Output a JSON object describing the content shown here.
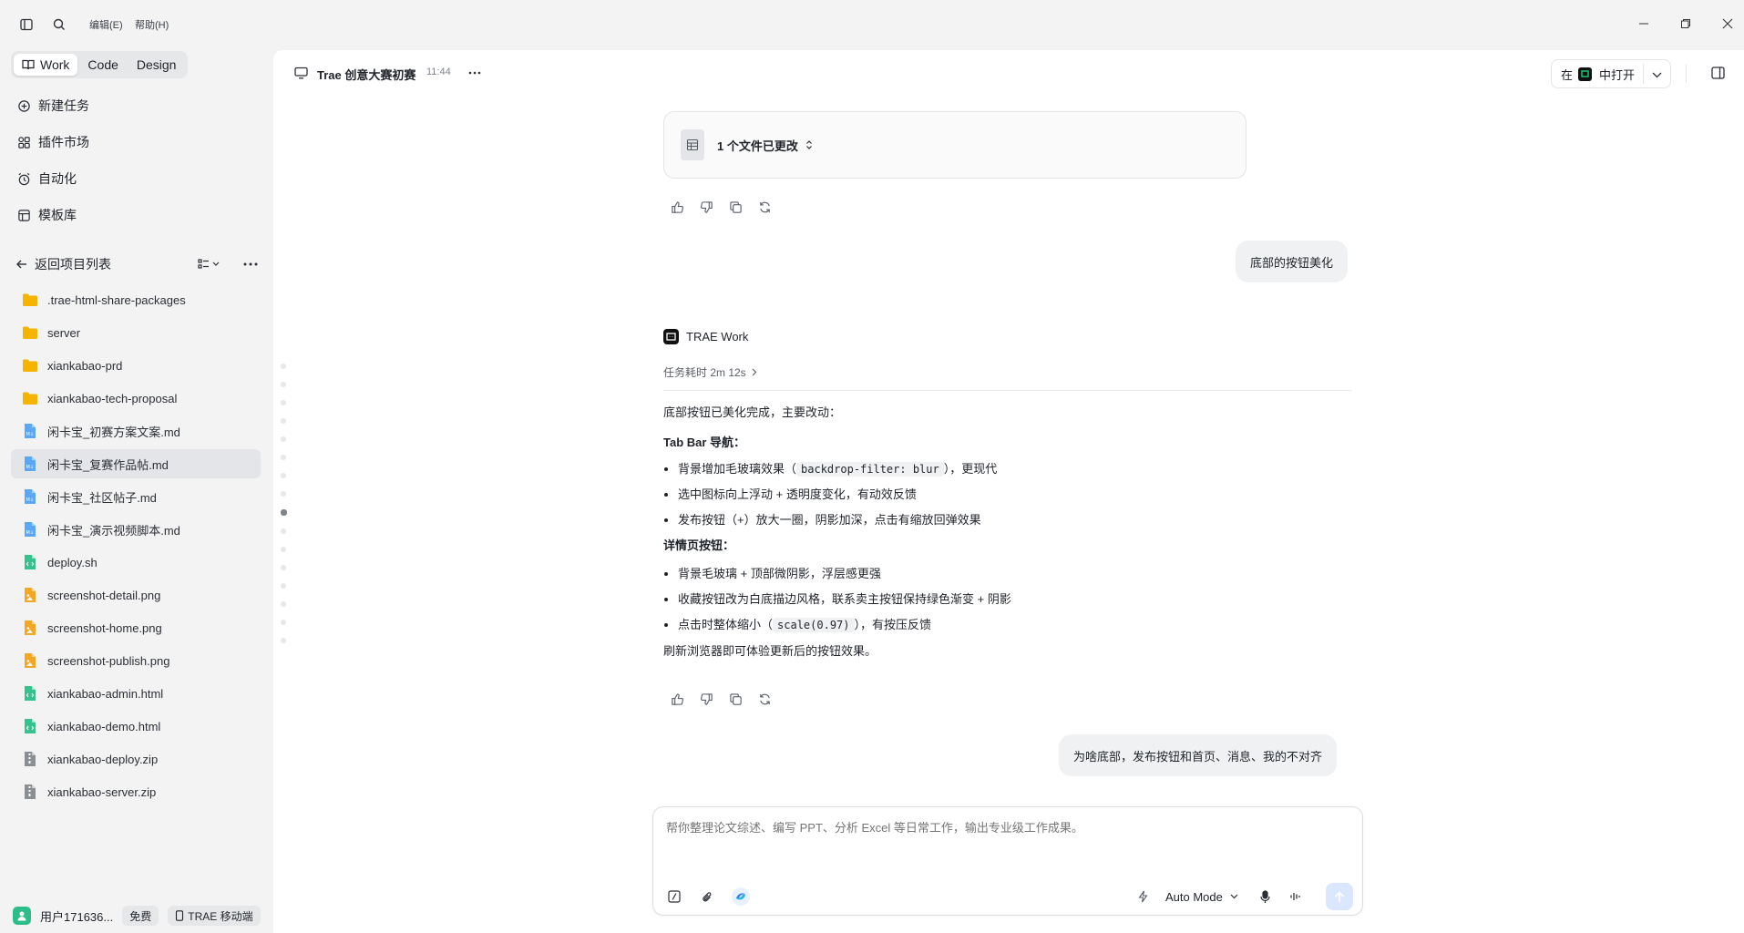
{
  "menu": {
    "edit": "编辑(E)",
    "help": "帮助(H)"
  },
  "modes": [
    {
      "label": "Work",
      "active": true
    },
    {
      "label": "Code",
      "active": false
    },
    {
      "label": "Design",
      "active": false
    }
  ],
  "nav": {
    "new_task": "新建任务",
    "plugins": "插件市场",
    "automation": "自动化",
    "templates": "模板库"
  },
  "project": {
    "back_label": "返回项目列表"
  },
  "files": [
    {
      "name": ".trae-html-share-packages",
      "type": "folder"
    },
    {
      "name": "server",
      "type": "folder"
    },
    {
      "name": "xiankabao-prd",
      "type": "folder"
    },
    {
      "name": "xiankabao-tech-proposal",
      "type": "folder"
    },
    {
      "name": "闲卡宝_初赛方案文案.md",
      "type": "md"
    },
    {
      "name": "闲卡宝_复赛作品帖.md",
      "type": "md",
      "selected": true
    },
    {
      "name": "闲卡宝_社区帖子.md",
      "type": "md"
    },
    {
      "name": "闲卡宝_演示视频脚本.md",
      "type": "md"
    },
    {
      "name": "deploy.sh",
      "type": "code"
    },
    {
      "name": "screenshot-detail.png",
      "type": "image"
    },
    {
      "name": "screenshot-home.png",
      "type": "image"
    },
    {
      "name": "screenshot-publish.png",
      "type": "image"
    },
    {
      "name": "xiankabao-admin.html",
      "type": "code"
    },
    {
      "name": "xiankabao-demo.html",
      "type": "code"
    },
    {
      "name": "xiankabao-deploy.zip",
      "type": "zip"
    },
    {
      "name": "xiankabao-server.zip",
      "type": "zip"
    }
  ],
  "user": {
    "name": "用户171636...",
    "plan": "免费",
    "mobile": "TRAE 移动端"
  },
  "header": {
    "title": "Trae 创意大赛初赛",
    "time": "11:44",
    "open_prefix": "在",
    "open_label": "中打开"
  },
  "file_card": {
    "label": "1 个文件已更改"
  },
  "messages": {
    "user1": "底部的按钮美化",
    "agent_name": "TRAE Work",
    "duration": "任务耗时 2m 12s",
    "intro": "底部按钮已美化完成，主要改动：",
    "section1_title": "Tab Bar 导航：",
    "s1_b1_pre": "背景增加毛玻璃效果（",
    "s1_b1_code": "backdrop-filter: blur",
    "s1_b1_post": "），更现代",
    "s1_b2": "选中图标向上浮动 + 透明度变化，有动效反馈",
    "s1_b3": "发布按钮（+）放大一圈，阴影加深，点击有缩放回弹效果",
    "section2_title": "详情页按钮：",
    "s2_b1": "背景毛玻璃 + 顶部微阴影，浮层感更强",
    "s2_b2": "收藏按钮改为白底描边风格，联系卖主按钮保持绿色渐变 + 阴影",
    "s2_b3_pre": "点击时整体缩小（",
    "s2_b3_code": "scale(0.97)",
    "s2_b3_post": "），有按压反馈",
    "outro": "刷新浏览器即可体验更新后的按钮效果。",
    "user2": "为啥底部，发布按钮和首页、消息、我的不对齐"
  },
  "composer": {
    "placeholder": "帮你整理论文综述、编写 PPT、分析 Excel 等日常工作，输出专业级工作成果。",
    "mode": "Auto Mode"
  }
}
